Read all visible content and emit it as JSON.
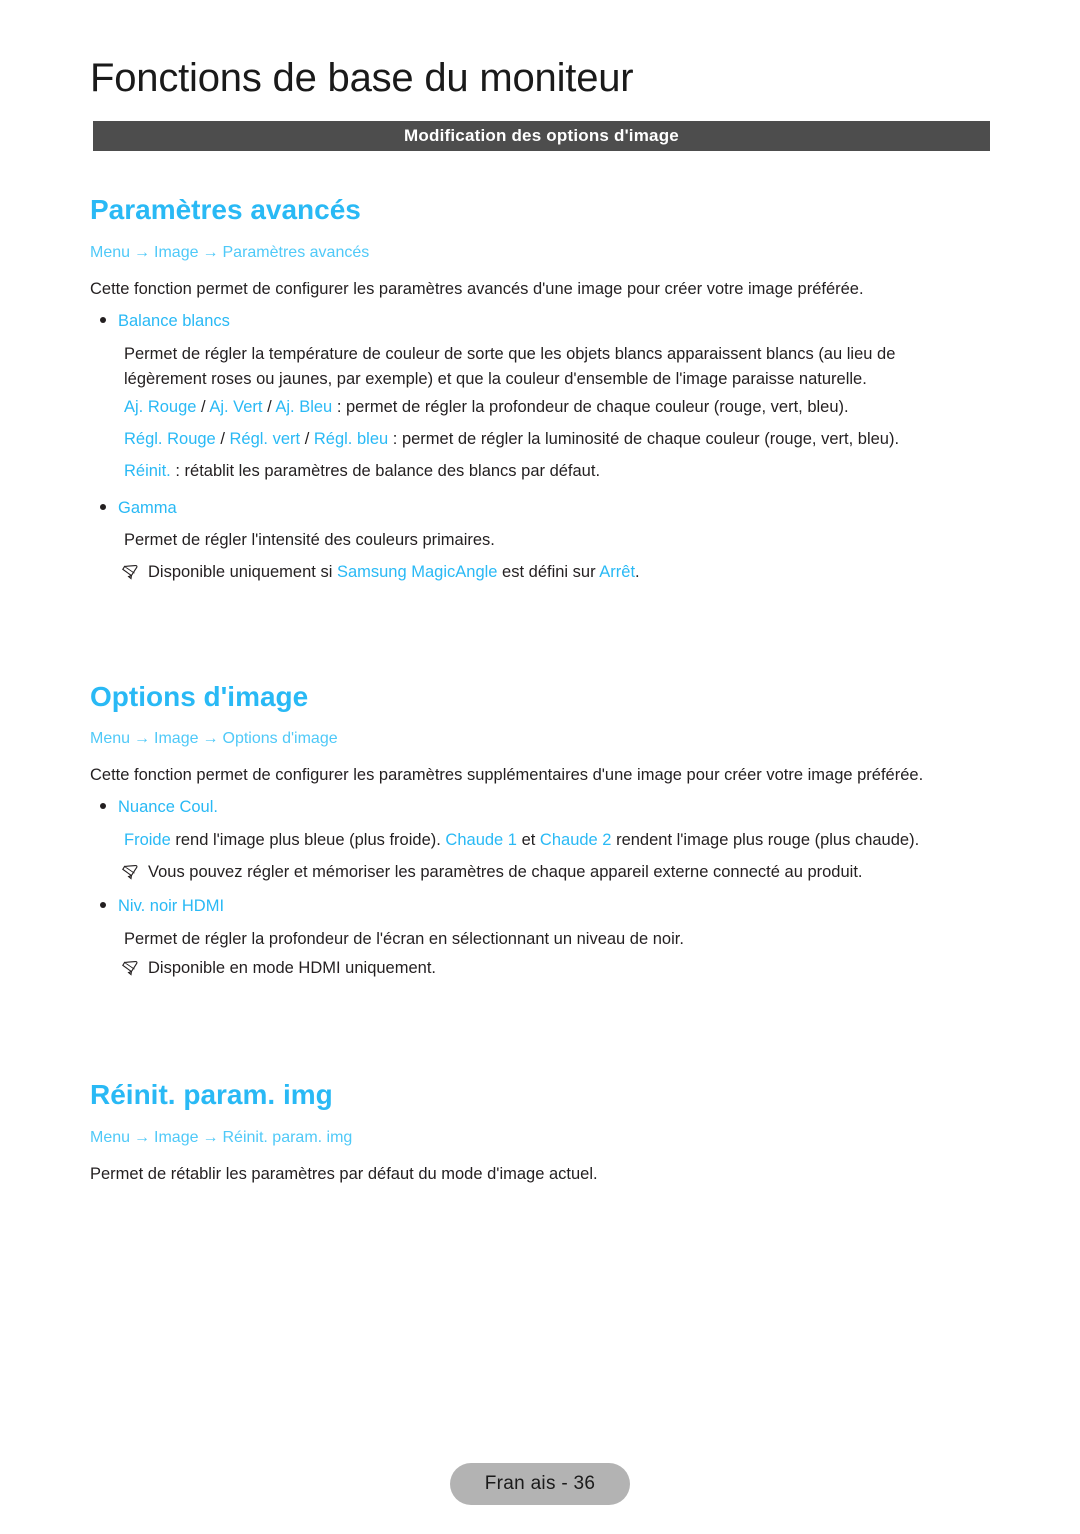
{
  "header": {
    "doc_title": "Fonctions de base du moniteur",
    "subtitle": "Modification des options d'image"
  },
  "colors": {
    "accent_cyan": "#29b9f5",
    "breadcrumb_cyan": "#4fc9f8",
    "subtitle_bar": "#4d4d4d",
    "footer_badge": "#b3b3b3",
    "body_text": "#231f20"
  },
  "sections": [
    {
      "heading": "Paramètres avancés",
      "breadcrumb": {
        "part1": "Menu",
        "part2": "Image",
        "part3": "Paramètres avancés",
        "arrow": "→"
      },
      "intro": "Cette fonction permet de configurer les paramètres avancés d'une image pour créer votre image préférée.",
      "bullets": [
        {
          "label": "Balance blancs",
          "description": "Permet de régler la température de couleur de sorte que les objets blancs apparaissent blancs (au lieu de légèrement roses ou jaunes, par exemple) et que la couleur d'ensemble de l'image paraisse naturelle.",
          "sub_lines": [
            {
              "term1": "Aj. Rouge",
              "sep1": " / ",
              "term2": "Aj. Vert",
              "sep2": " / ",
              "term3": "Aj. Bleu",
              "rest": " : permet de régler la profondeur de chaque couleur (rouge, vert, bleu)."
            },
            {
              "term1": "Régl. Rouge",
              "sep1": " / ",
              "term2": "Régl. vert",
              "sep2": " / ",
              "term3": "Régl. bleu",
              "rest": " : permet de régler la luminosité de chaque couleur (rouge, vert, bleu)."
            },
            {
              "term1": "Réinit.",
              "rest": " : rétablit les paramètres de balance des blancs par défaut."
            }
          ]
        },
        {
          "label": "Gamma",
          "description": "Permet de régler l'intensité des couleurs primaires.",
          "note": {
            "icon": "pencil-note-icon",
            "text_before": "Disponible uniquement si ",
            "highlight1": "Samsung MagicAngle",
            "text_middle": " est défini sur ",
            "highlight2": "Arrêt",
            "text_after": "."
          }
        }
      ]
    },
    {
      "heading": "Options d'image",
      "breadcrumb": {
        "part1": "Menu",
        "part2": "Image",
        "part3": "Options d'image",
        "arrow": "→"
      },
      "intro": "Cette fonction permet de configurer les paramètres supplémentaires d'une image pour créer votre image préférée.",
      "bullets": [
        {
          "label": "Nuance Coul.",
          "desc_line": {
            "term1": "Froide",
            "text1": " rend l'image plus bleue (plus froide). ",
            "term2": "Chaude 1",
            "text2": " et ",
            "term3": "Chaude 2",
            "text3": " rendent l'image plus rouge (plus chaude)."
          },
          "note": {
            "icon": "pencil-note-icon",
            "text": "Vous pouvez régler et mémoriser les paramètres de chaque appareil externe connecté au produit."
          }
        },
        {
          "label": "Niv. noir HDMI",
          "description": "Permet de régler la profondeur de l'écran en sélectionnant un niveau de noir.",
          "note": {
            "icon": "pencil-note-icon",
            "text": "Disponible en mode HDMI uniquement."
          }
        }
      ]
    },
    {
      "heading": "Réinit. param. img",
      "breadcrumb": {
        "part1": "Menu",
        "part2": "Image",
        "part3": "Réinit. param. img",
        "arrow": "→"
      },
      "intro": "Permet de rétablir les paramètres par défaut du mode d'image actuel."
    }
  ],
  "footer": {
    "page_label": "Fran ais - 36"
  }
}
